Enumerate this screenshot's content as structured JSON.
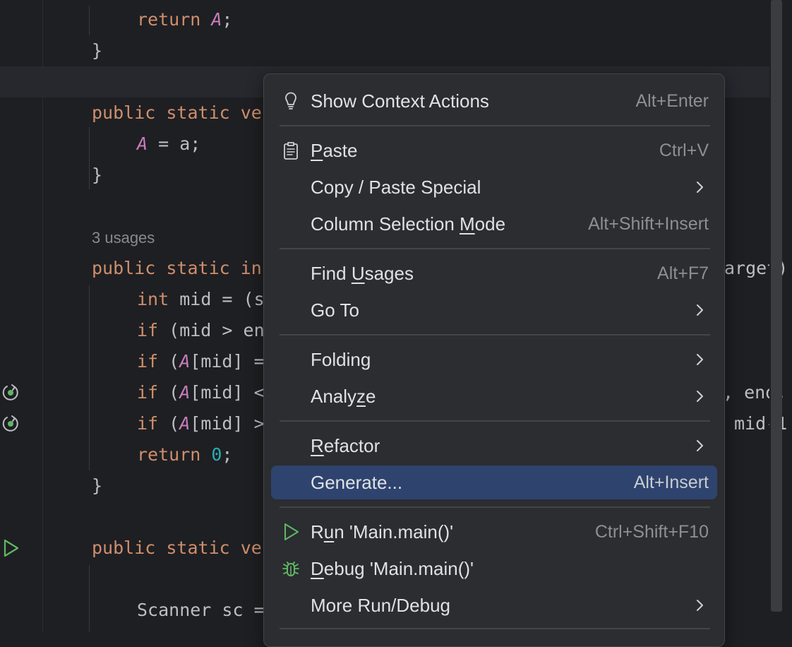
{
  "editor": {
    "code_lines": [
      {
        "indent": 1,
        "parts": [
          [
            "kw",
            "return "
          ],
          [
            "st",
            "A"
          ],
          [
            "",
            "; "
          ]
        ]
      },
      {
        "indent": 0,
        "parts": [
          [
            "",
            "}"
          ]
        ]
      },
      {
        "indent": 0,
        "parts": []
      },
      {
        "indent": 0,
        "parts": [
          [
            "kw",
            "public "
          ],
          [
            "kw",
            "static "
          ],
          [
            "kw",
            "ve"
          ]
        ]
      },
      {
        "indent": 1,
        "parts": [
          [
            "st",
            "A"
          ],
          [
            "",
            " = a;"
          ]
        ]
      },
      {
        "indent": 0,
        "parts": [
          [
            "",
            "}"
          ]
        ]
      },
      {
        "indent": 0,
        "parts": []
      },
      {
        "indent": 0,
        "hint": "3 usages"
      },
      {
        "indent": 0,
        "parts": [
          [
            "kw",
            "public "
          ],
          [
            "kw",
            "static "
          ],
          [
            "kw",
            "in"
          ]
        ],
        "tail": "arget)"
      },
      {
        "indent": 1,
        "parts": [
          [
            "kw",
            "int "
          ],
          [
            "",
            "mid = (s"
          ]
        ]
      },
      {
        "indent": 1,
        "parts": [
          [
            "kw",
            "if "
          ],
          [
            "",
            "(mid > en"
          ]
        ]
      },
      {
        "indent": 1,
        "parts": [
          [
            "kw",
            "if "
          ],
          [
            "",
            "("
          ],
          [
            "st",
            "A"
          ],
          [
            "",
            "[mid] ="
          ]
        ]
      },
      {
        "indent": 1,
        "parts": [
          [
            "kw",
            "if "
          ],
          [
            "",
            "("
          ],
          [
            "st",
            "A"
          ],
          [
            "",
            "[mid] <"
          ]
        ],
        "tail": ", end,"
      },
      {
        "indent": 1,
        "parts": [
          [
            "kw",
            "if "
          ],
          [
            "",
            "("
          ],
          [
            "st",
            "A"
          ],
          [
            "",
            "[mid] >"
          ]
        ],
        "tail": "mid-1"
      },
      {
        "indent": 1,
        "parts": [
          [
            "kw",
            "return "
          ],
          [
            "num",
            "0"
          ],
          [
            "",
            ";"
          ]
        ]
      },
      {
        "indent": 0,
        "parts": [
          [
            "",
            "}"
          ]
        ]
      },
      {
        "indent": 0,
        "parts": []
      },
      {
        "indent": 0,
        "parts": [
          [
            "kw",
            "public "
          ],
          [
            "kw",
            "static "
          ],
          [
            "kw",
            "ve"
          ]
        ]
      },
      {
        "indent": 0,
        "parts": []
      },
      {
        "indent": 1,
        "parts": [
          [
            "",
            "Scanner sc ="
          ]
        ]
      }
    ],
    "gutter_icons": [
      "recursive-call-icon",
      "recursive-call-icon",
      "run-icon"
    ]
  },
  "context_menu": {
    "items": [
      {
        "label": "Show Context Actions",
        "mnemonic": "",
        "shortcut": "Alt+Enter",
        "icon": "lightbulb-icon",
        "submenu": false
      },
      {
        "label": "Paste",
        "mnemonic": "P",
        "shortcut": "Ctrl+V",
        "icon": "clipboard-icon",
        "submenu": false
      },
      {
        "label": "Copy / Paste Special",
        "mnemonic": "",
        "shortcut": "",
        "icon": "",
        "submenu": true
      },
      {
        "label": "Column Selection Mode",
        "mnemonic": "M",
        "shortcut": "Alt+Shift+Insert",
        "icon": "",
        "submenu": false
      },
      {
        "label": "Find Usages",
        "mnemonic": "U",
        "shortcut": "Alt+F7",
        "icon": "",
        "submenu": false
      },
      {
        "label": "Go To",
        "mnemonic": "",
        "shortcut": "",
        "icon": "",
        "submenu": true
      },
      {
        "label": "Folding",
        "mnemonic": "",
        "shortcut": "",
        "icon": "",
        "submenu": true
      },
      {
        "label": "Analyze",
        "mnemonic": "z",
        "shortcut": "",
        "icon": "",
        "submenu": true
      },
      {
        "label": "Refactor",
        "mnemonic": "R",
        "shortcut": "",
        "icon": "",
        "submenu": true
      },
      {
        "label": "Generate...",
        "mnemonic": "",
        "shortcut": "Alt+Insert",
        "icon": "",
        "submenu": false,
        "selected": true
      },
      {
        "label": "Run 'Main.main()'",
        "mnemonic": "u",
        "shortcut": "Ctrl+Shift+F10",
        "icon": "run-icon",
        "submenu": false
      },
      {
        "label": "Debug 'Main.main()'",
        "mnemonic": "D",
        "shortcut": "",
        "icon": "debug-icon",
        "submenu": false
      },
      {
        "label": "More Run/Debug",
        "mnemonic": "",
        "shortcut": "",
        "icon": "",
        "submenu": true
      }
    ]
  },
  "colors": {
    "editor_bg": "#1e1f22",
    "menu_bg": "#2b2d30",
    "selection": "#2e436e",
    "keyword": "#cf8e6d",
    "static_field": "#c77dbb",
    "number": "#2aacb8",
    "icon_green": "#5fb865"
  }
}
